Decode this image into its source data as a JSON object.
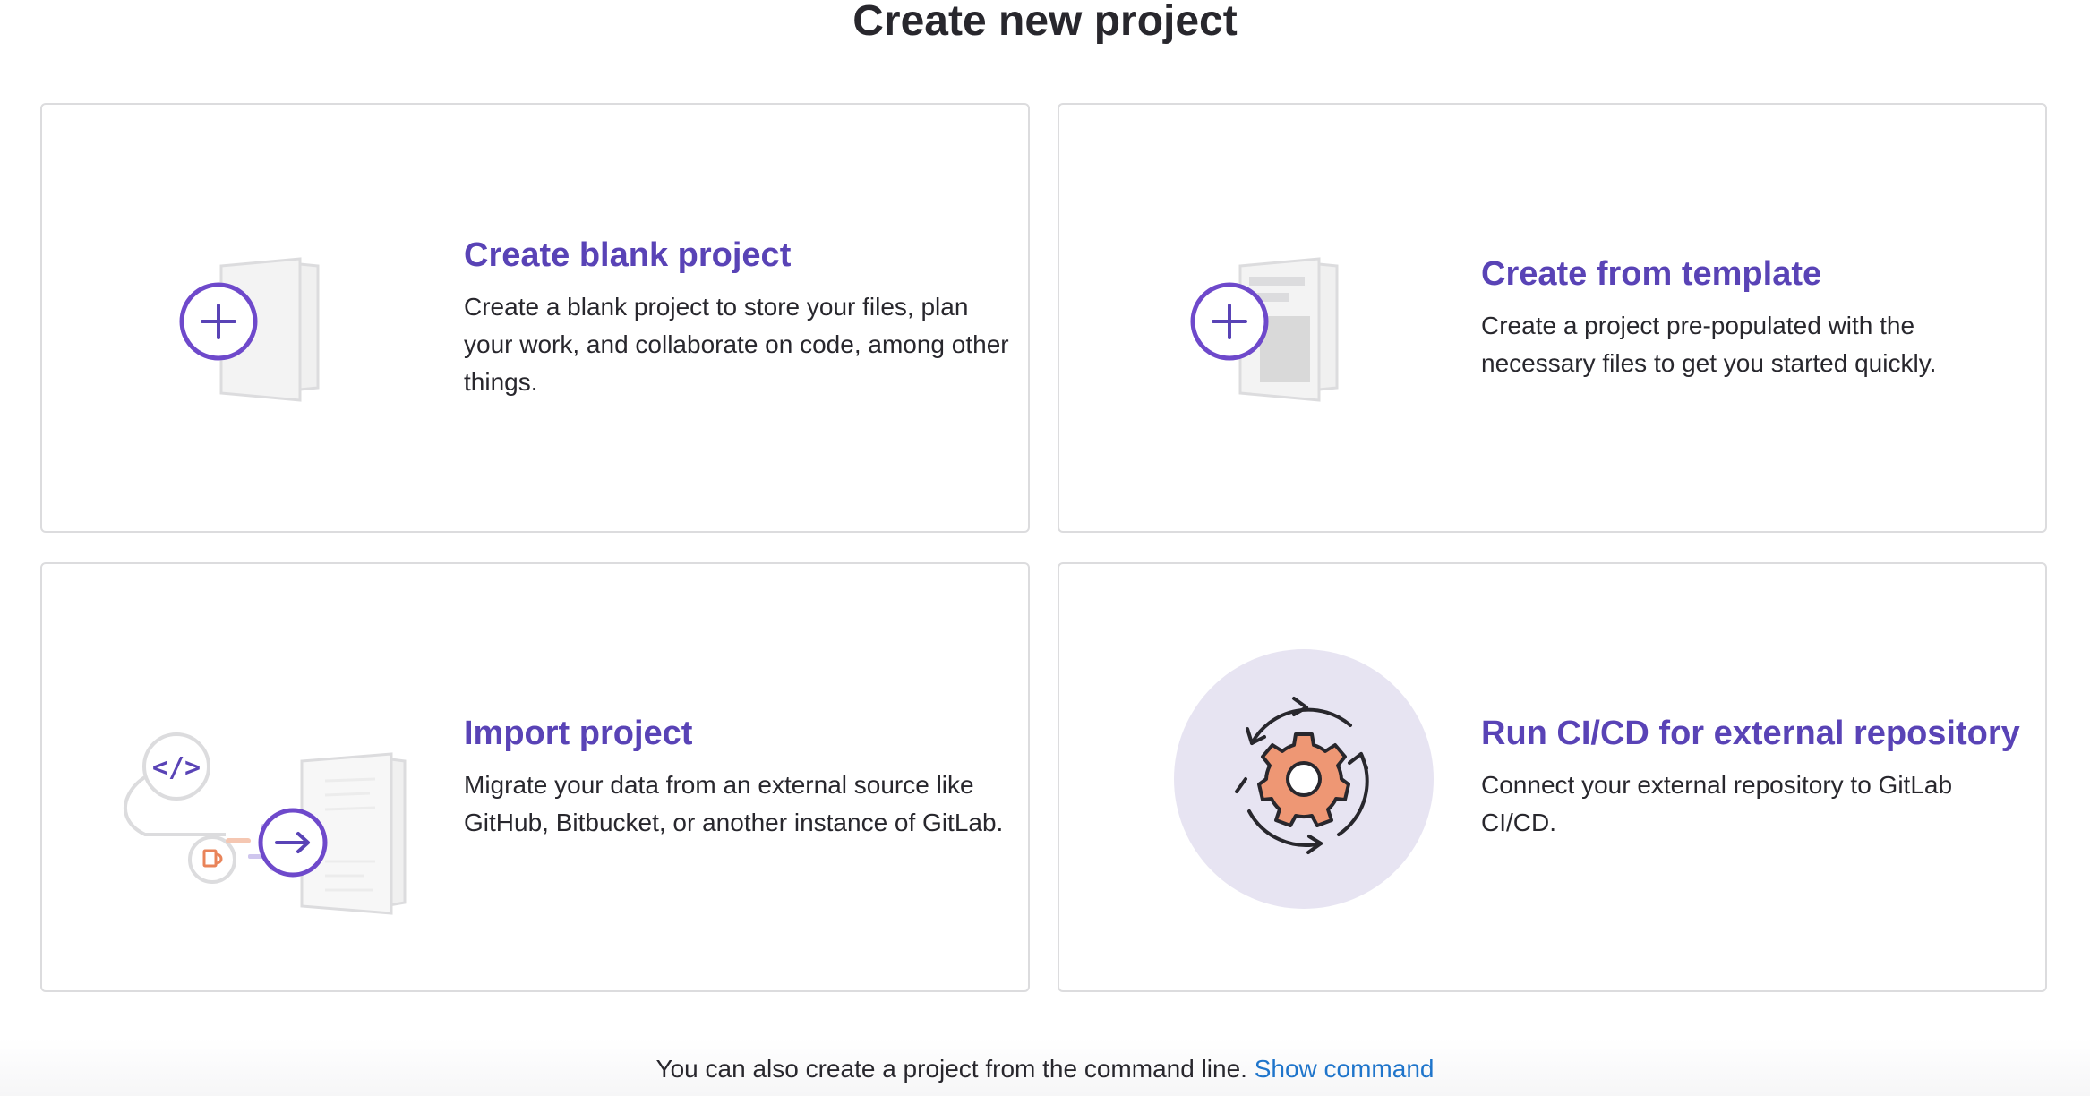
{
  "page": {
    "title": "Create new project"
  },
  "cards": [
    {
      "title": "Create blank project",
      "description": "Create a blank project to store your files, plan your work, and collaborate on code, among other things.",
      "icon": "blank-project-illustration"
    },
    {
      "title": "Create from template",
      "description": "Create a project pre-populated with the necessary files to get you started quickly.",
      "icon": "template-project-illustration"
    },
    {
      "title": "Import project",
      "description": "Migrate your data from an external source like GitHub, Bitbucket, or another instance of GitLab.",
      "icon": "import-project-illustration"
    },
    {
      "title": "Run CI/CD for external repository",
      "description": "Connect your external repository to GitLab CI/CD.",
      "icon": "cicd-gear-illustration"
    }
  ],
  "footer": {
    "text": "You can also create a project from the command line.",
    "link_label": "Show command"
  },
  "colors": {
    "accent_purple": "#5943b6",
    "link_blue": "#1f75cb",
    "gear_orange": "#ee9774",
    "icon_outline_gray": "#dcdcde",
    "circle_bg": "#e7e4f2"
  }
}
